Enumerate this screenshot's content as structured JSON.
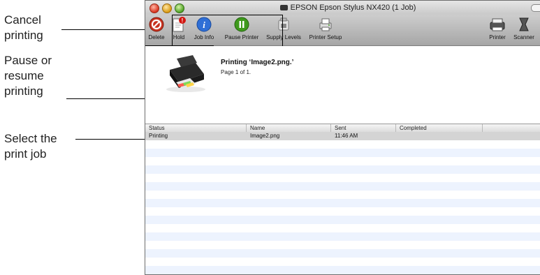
{
  "callouts": {
    "cancel": [
      "Cancel",
      "printing"
    ],
    "pause": [
      "Pause or",
      "resume",
      "printing"
    ],
    "select": [
      "Select the",
      "print job"
    ]
  },
  "window": {
    "title": "EPSON Epson Stylus NX420 (1 Job)"
  },
  "toolbar": {
    "items": [
      {
        "label": "Delete",
        "icon": "delete-icon"
      },
      {
        "label": "Hold",
        "icon": "hold-icon"
      },
      {
        "label": "Job Info",
        "icon": "info-icon"
      },
      {
        "label": "Pause Printer",
        "icon": "pause-icon"
      },
      {
        "label": "Supply Levels",
        "icon": "supply-levels-icon"
      },
      {
        "label": "Printer Setup",
        "icon": "printer-setup-icon"
      }
    ],
    "right_items": [
      {
        "label": "Printer",
        "icon": "printer-icon"
      },
      {
        "label": "Scanner",
        "icon": "scanner-icon"
      }
    ]
  },
  "job": {
    "title": "Printing ‘Image2.png.’",
    "page": "Page 1 of 1."
  },
  "table": {
    "headers": [
      "Status",
      "Name",
      "Sent",
      "Completed"
    ],
    "rows": [
      {
        "status": "Printing",
        "name": "Image2.png",
        "sent": "11:46 AM",
        "completed": ""
      }
    ]
  },
  "colors": {
    "delete": "#c8321f",
    "info": "#2f6fd6",
    "pause": "#3f9a1d",
    "stripe": "#edf3fe",
    "selected_row": "#d4d4d4"
  }
}
